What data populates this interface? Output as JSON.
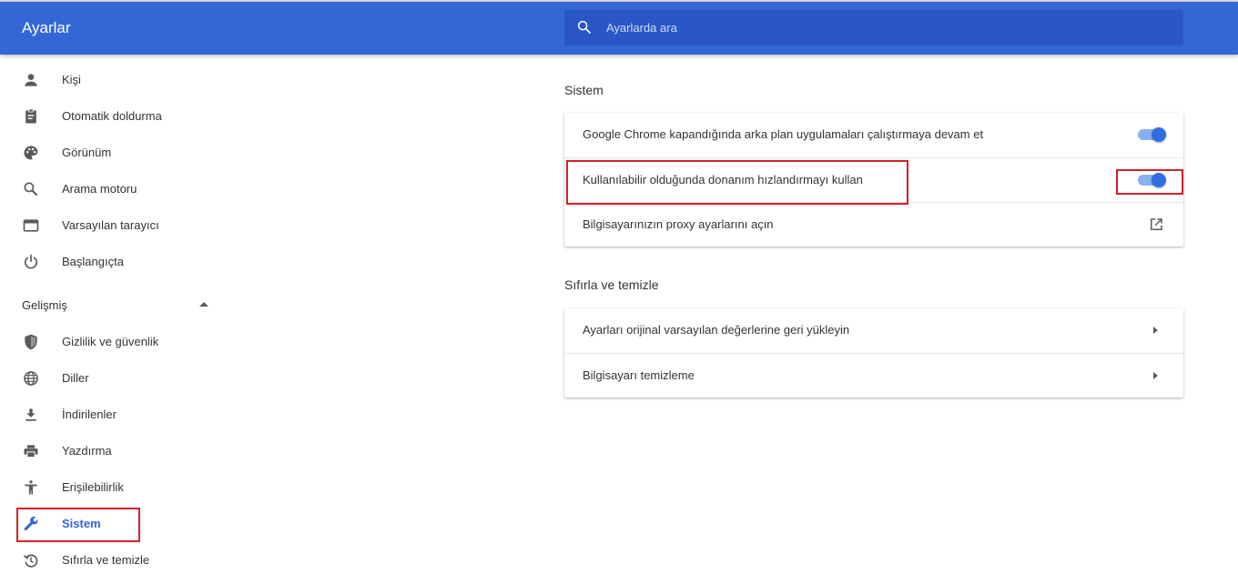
{
  "header": {
    "title": "Ayarlar",
    "search_placeholder": "Ayarlarda ara"
  },
  "sidebar": {
    "items": [
      {
        "label": "Kişi",
        "icon": "person-icon"
      },
      {
        "label": "Otomatik doldurma",
        "icon": "clipboard-icon"
      },
      {
        "label": "Görünüm",
        "icon": "palette-icon"
      },
      {
        "label": "Arama motoru",
        "icon": "search-icon"
      },
      {
        "label": "Varsayılan tarayıcı",
        "icon": "browser-icon"
      },
      {
        "label": "Başlangıçta",
        "icon": "power-icon"
      }
    ],
    "advanced_label": "Gelişmiş",
    "advanced_items": [
      {
        "label": "Gizlilik ve güvenlik",
        "icon": "shield-icon"
      },
      {
        "label": "Diller",
        "icon": "globe-icon"
      },
      {
        "label": "İndirilenler",
        "icon": "download-icon"
      },
      {
        "label": "Yazdırma",
        "icon": "printer-icon"
      },
      {
        "label": "Erişilebilirlik",
        "icon": "accessibility-icon"
      },
      {
        "label": "Sistem",
        "icon": "wrench-icon",
        "selected": true
      },
      {
        "label": "Sıfırla ve temizle",
        "icon": "restore-icon"
      }
    ]
  },
  "main": {
    "system_section": {
      "title": "Sistem",
      "rows": [
        {
          "label": "Google Chrome kapandığında arka plan uygulamaları çalıştırmaya devam et",
          "control": "toggle",
          "checked": true
        },
        {
          "label": "Kullanılabilir olduğunda donanım hızlandırmayı kullan",
          "control": "toggle",
          "checked": true
        },
        {
          "label": "Bilgisayarınızın proxy ayarlarını açın",
          "control": "external-link-icon"
        }
      ]
    },
    "reset_section": {
      "title": "Sıfırla ve temizle",
      "rows": [
        {
          "label": "Ayarları orijinal varsayılan değerlerine geri yükleyin",
          "control": "chevron-right-icon"
        },
        {
          "label": "Bilgisayarı temizleme",
          "control": "chevron-right-icon"
        }
      ]
    }
  },
  "colors": {
    "header_bg": "#3367d6",
    "search_bg": "#2a56c6",
    "accent": "#3367d6",
    "toggle_knob": "#2f6de1",
    "toggle_track": "#8ab0f0",
    "highlight_box": "#d32027"
  }
}
